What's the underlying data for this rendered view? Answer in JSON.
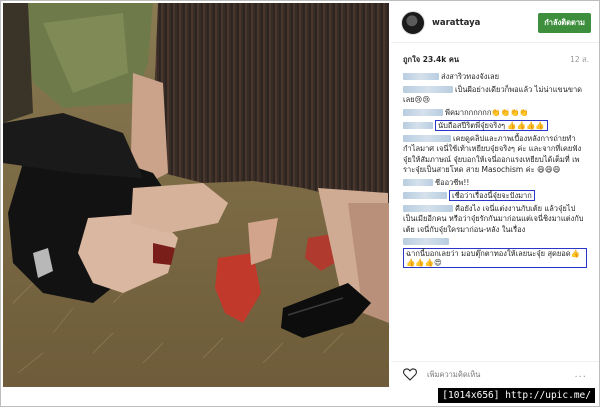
{
  "post": {
    "username": "warattaya",
    "follow_label": "กำลังติดตาม",
    "likes": "ถูกใจ 23.4k คน",
    "time": "12 ส.",
    "comment_placeholder": "เพิ่มความคิดเห็น",
    "more_label": "..."
  },
  "comments": [
    {
      "user_width": 36,
      "text": "ส่งสาริวทองจังเลย",
      "highlight": false
    },
    {
      "user_width": 50,
      "text": "เป็นผีอย่างเดียวก็พอแล้ว ไม่น่าแขนขาดเลย😢😢",
      "highlight": false
    },
    {
      "user_width": 40,
      "text": "พีคมากกกกกก👏👏👏👏",
      "highlight": false
    },
    {
      "user_width": 30,
      "text": "นับถือสปีริตพี่จุ๋ยจริงๆ 👍👍👍👍",
      "highlight": true
    },
    {
      "user_width": 48,
      "text": "เคยดูคลิปและภาพเบื้องหลังการถ่ายทำกำไลมาศ เจนี่ใช้เท้าเหยียบจุ๋ยจริงๆ ค่ะ และจากที่เคยฟังจุ๋ยให้สัมภาษณ์ จุ๋ยบอกให้เจนี่ออกแรงเหยียบได้เต็มที่ เพราะจุ๋ยเป็นสายโหด สาย Masochism ค่ะ 😄😄😄",
      "highlight": false
    },
    {
      "user_width": 30,
      "text": "ชีออวชีพ!!",
      "highlight": false
    },
    {
      "user_width": 44,
      "text": "เชื่อว่าเรื่องนี้จุ๋ยจะปังมาก",
      "highlight": true
    },
    {
      "user_width": 50,
      "text": "คือยังไง เจนี่แต่งงานกับเต้ย แล้วจุ๋ยไปเป็นเมียอีกคน หรือว่าจุ๋ยรักกันมาก่อนแต่เจนี่ชิงมาแต่งกับเต้ย เจนี่กับจุ๋ยใครมาก่อน-หลัง ในเรื่อง",
      "highlight": false
    },
    {
      "user_width": 46,
      "text": "ฉากนี้บอกเลยว่า มอบตุ๊กตาทองให้เลยนะจุ๋ย สุดยอด👍👍👍👍😍",
      "highlight": true
    }
  ],
  "icons": {
    "heart": "heart-icon",
    "avatar": "avatar"
  },
  "watermark": "[1014x656] http://upic.me/",
  "colors": {
    "follow_button": "#3d8f3d",
    "highlight_border": "#2a35c9"
  }
}
